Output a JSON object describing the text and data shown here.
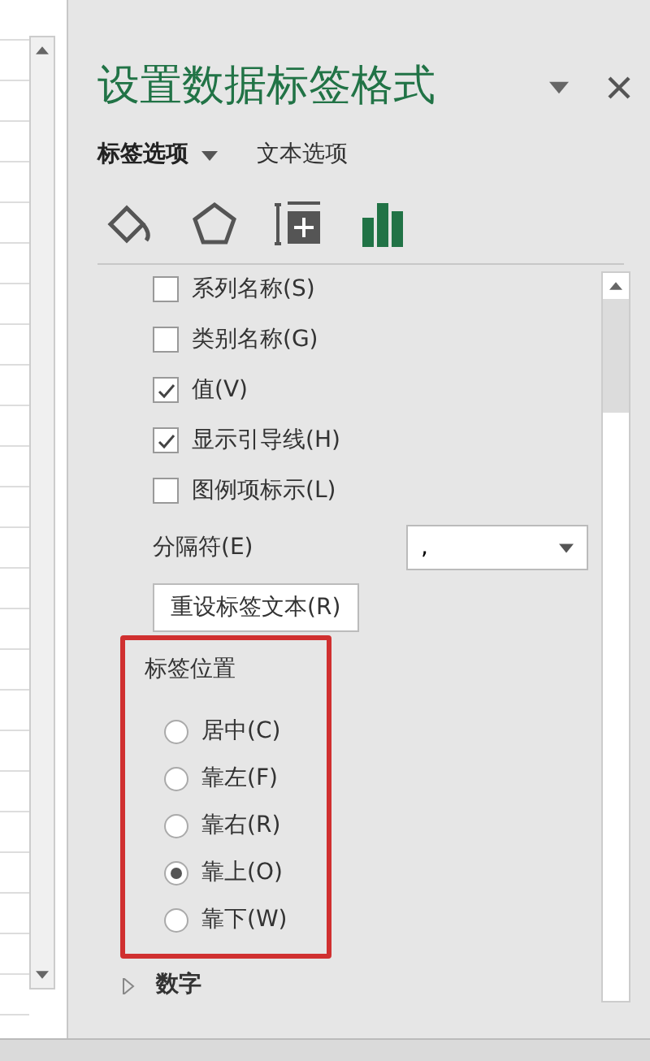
{
  "panel": {
    "title": "设置数据标签格式",
    "tabs": [
      {
        "label": "标签选项",
        "selected": true,
        "has_menu": true
      },
      {
        "label": "文本选项",
        "selected": false,
        "has_menu": false
      }
    ],
    "icon_tabs": [
      {
        "kind": "fill",
        "selected": false
      },
      {
        "kind": "shape",
        "selected": false
      },
      {
        "kind": "size",
        "selected": false
      },
      {
        "kind": "chart",
        "selected": true
      }
    ],
    "checkboxes": [
      {
        "label": "系列名称(S)",
        "checked": false
      },
      {
        "label": "类别名称(G)",
        "checked": false
      },
      {
        "label": "值(V)",
        "checked": true
      },
      {
        "label": "显示引导线(H)",
        "checked": true
      },
      {
        "label": "图例项标示(L)",
        "checked": false
      }
    ],
    "separator": {
      "label": "分隔符(E)",
      "value": ","
    },
    "reset_button": "重设标签文本(R)",
    "label_position": {
      "title": "标签位置",
      "highlighted": true,
      "options": [
        {
          "label": "居中(C)",
          "selected": false
        },
        {
          "label": "靠左(F)",
          "selected": false
        },
        {
          "label": "靠右(R)",
          "selected": false
        },
        {
          "label": "靠上(O)",
          "selected": true
        },
        {
          "label": "靠下(W)",
          "selected": false
        }
      ]
    },
    "number_section": {
      "label": "数字",
      "expanded": false
    }
  }
}
